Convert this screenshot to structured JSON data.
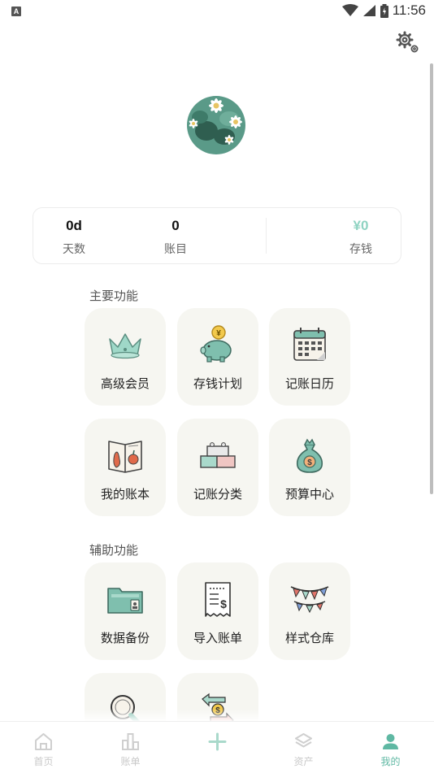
{
  "status_bar": {
    "time": "11:56",
    "notification_letter": "A"
  },
  "stats": [
    {
      "value": "0d",
      "label": "天数"
    },
    {
      "value": "0",
      "label": "账目"
    },
    {
      "value": "¥0",
      "label": "存钱"
    }
  ],
  "sections": {
    "main": {
      "title": "主要功能",
      "items": [
        {
          "label": "高级会员",
          "icon": "crown-icon"
        },
        {
          "label": "存钱计划",
          "icon": "piggy-bank-icon"
        },
        {
          "label": "记账日历",
          "icon": "calendar-icon"
        },
        {
          "label": "我的账本",
          "icon": "ledger-book-icon"
        },
        {
          "label": "记账分类",
          "icon": "category-blocks-icon"
        },
        {
          "label": "预算中心",
          "icon": "money-bag-icon"
        }
      ]
    },
    "aux": {
      "title": "辅助功能",
      "items": [
        {
          "label": "数据备份",
          "icon": "folder-backup-icon"
        },
        {
          "label": "导入账单",
          "icon": "receipt-import-icon"
        },
        {
          "label": "样式仓库",
          "icon": "bunting-flags-icon"
        },
        {
          "label": "",
          "icon": "magnifier-icon"
        },
        {
          "label": "",
          "icon": "currency-exchange-icon"
        }
      ]
    }
  },
  "nav": [
    {
      "label": "首页",
      "icon": "home-icon",
      "active": false
    },
    {
      "label": "账单",
      "icon": "bill-chart-icon",
      "active": false
    },
    {
      "label": "",
      "icon": "add-icon",
      "active": false
    },
    {
      "label": "资产",
      "icon": "layers-icon",
      "active": false
    },
    {
      "label": "我的",
      "icon": "person-icon",
      "active": true
    }
  ],
  "colors": {
    "accent": "#5fb8a3",
    "money": "#8fd3c2",
    "tile_bg": "#f6f6f1",
    "inactive": "#c9c9c9"
  }
}
